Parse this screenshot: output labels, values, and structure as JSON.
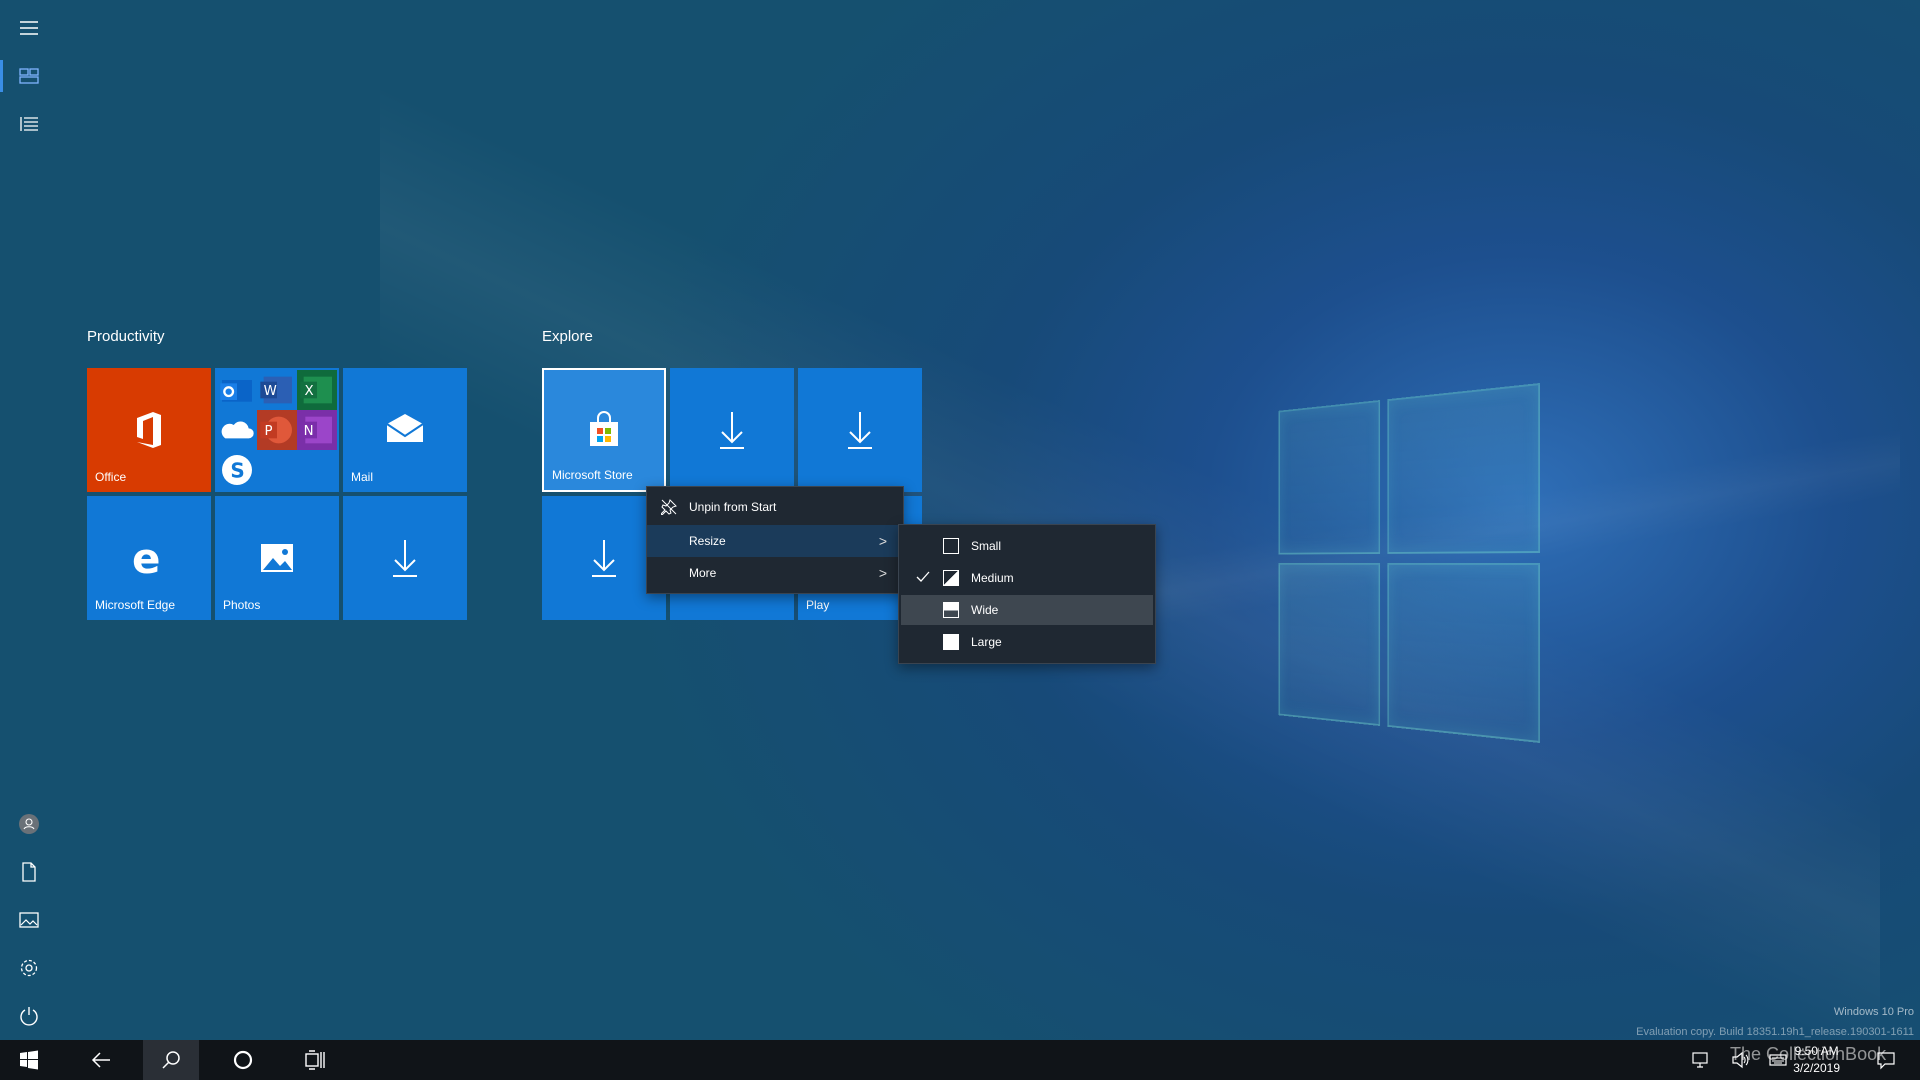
{
  "groups": {
    "productivity": {
      "title": "Productivity"
    },
    "explore": {
      "title": "Explore"
    }
  },
  "tiles": {
    "office": "Office",
    "mail": "Mail",
    "edge": "Microsoft Edge",
    "photos": "Photos",
    "store": "Microsoft Store",
    "play": "Play"
  },
  "context_menu": {
    "unpin": "Unpin from Start",
    "resize": "Resize",
    "more": "More",
    "chevron": ">"
  },
  "resize_menu": {
    "small": "Small",
    "medium": "Medium",
    "wide": "Wide",
    "large": "Large",
    "selected": "Medium",
    "hovered": "Wide"
  },
  "watermark": {
    "edition": "Windows 10 Pro",
    "build": "Evaluation copy. Build 18351.19h1_release.190301-1611",
    "brand": "The CollectionBook"
  },
  "clock": {
    "time": "9:50 AM",
    "date": "3/2/2019"
  },
  "colors": {
    "tile_blue": "#1178d6",
    "office_orange": "#d83b01",
    "menu_bg": "#1f2832",
    "taskbar_bg": "#101418",
    "accent": "#3a8ee6"
  },
  "icons": {
    "hamburger": "hamburger-icon",
    "tiles_view": "tiles-view-icon",
    "list_view": "list-view-icon",
    "user": "user-icon",
    "documents": "document-icon",
    "pictures": "pictures-icon",
    "settings": "gear-icon",
    "power": "power-icon"
  }
}
